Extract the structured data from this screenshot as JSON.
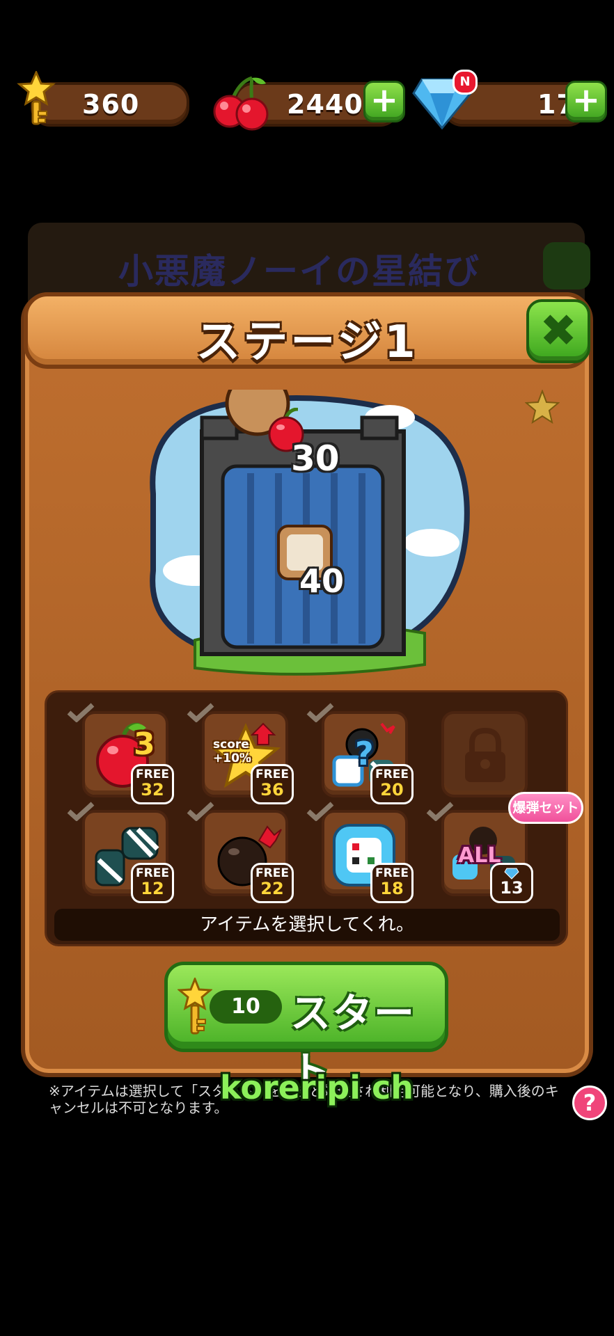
{
  "currency": {
    "keys": {
      "icon": "golden-key-icon",
      "value": "360"
    },
    "cherries": {
      "icon": "cherry-icon",
      "value": "2440",
      "add_icon": "plus-icon"
    },
    "gems": {
      "icon": "diamond-icon",
      "value": "17",
      "badge": "N",
      "add_icon": "plus-icon"
    }
  },
  "background": {
    "title": "小悪魔ノーイの星結び"
  },
  "dialog": {
    "title": "ステージ1",
    "close_icon": "close-icon",
    "side_star_icon": "star-icon",
    "stage_goals": [
      {
        "icon": "apple-icon",
        "count": "30"
      },
      {
        "icon": "block-icon",
        "count": "40"
      }
    ]
  },
  "items": [
    {
      "name": "apple",
      "icon": "apple-icon",
      "label": "3",
      "free": "FREE",
      "count": "32"
    },
    {
      "name": "score-boost",
      "icon": "star-score-icon",
      "label": "score +10%",
      "free": "FREE",
      "count": "36"
    },
    {
      "name": "random",
      "icon": "random-item-icon",
      "label": "?",
      "free": "FREE",
      "count": "20"
    },
    {
      "name": "locked",
      "icon": "lock-icon",
      "label": "",
      "free": "",
      "count": ""
    },
    {
      "name": "striped",
      "icon": "striped-candy-icon",
      "label": "",
      "free": "FREE",
      "count": "12"
    },
    {
      "name": "bomb",
      "icon": "bomb-icon",
      "label": "",
      "free": "FREE",
      "count": "22"
    },
    {
      "name": "dice-block",
      "icon": "dice-block-icon",
      "label": "",
      "free": "FREE",
      "count": "18"
    },
    {
      "name": "all-set",
      "icon": "all-set-icon",
      "label": "ALL",
      "free": "",
      "count": "13",
      "gem_icon": "diamond-icon"
    }
  ],
  "bomb_set_tag": "爆弾セット",
  "hint": "アイテムを選択してくれ。",
  "start": {
    "key_icon": "golden-key-icon",
    "cost": "10",
    "label": "スタート"
  },
  "footnote": "※アイテムは選択して「スタート」を押すと処理され利用可能となり、購入後のキャンセルは不可となります。",
  "watermark": "koreripi ch",
  "help_icon": "?",
  "colors": {
    "wood": "#b0632a",
    "green": "#4fb52a",
    "gold": "#ffd53a",
    "pink": "#f0509a"
  }
}
